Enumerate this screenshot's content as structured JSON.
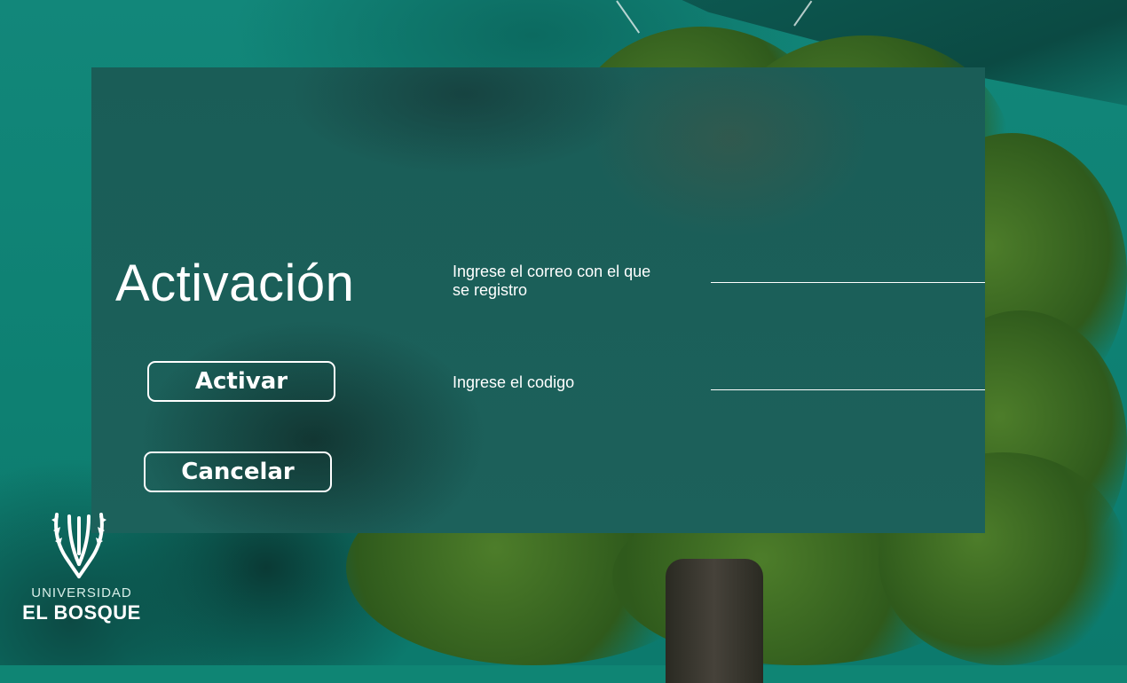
{
  "form": {
    "title": "Activación",
    "email_label": "Ingrese el correo con el que se registro",
    "email_value": "",
    "code_label": "Ingrese el codigo",
    "code_value": ""
  },
  "buttons": {
    "activate_label": "Activar",
    "cancel_label": "Cancelar"
  },
  "logo": {
    "line1": "UNIVERSIDAD",
    "line2": "EL BOSQUE",
    "icon": "university-crest-icon"
  },
  "colors": {
    "background": "#0f8574",
    "panel": "#1b5f59",
    "text": "#ffffff"
  }
}
